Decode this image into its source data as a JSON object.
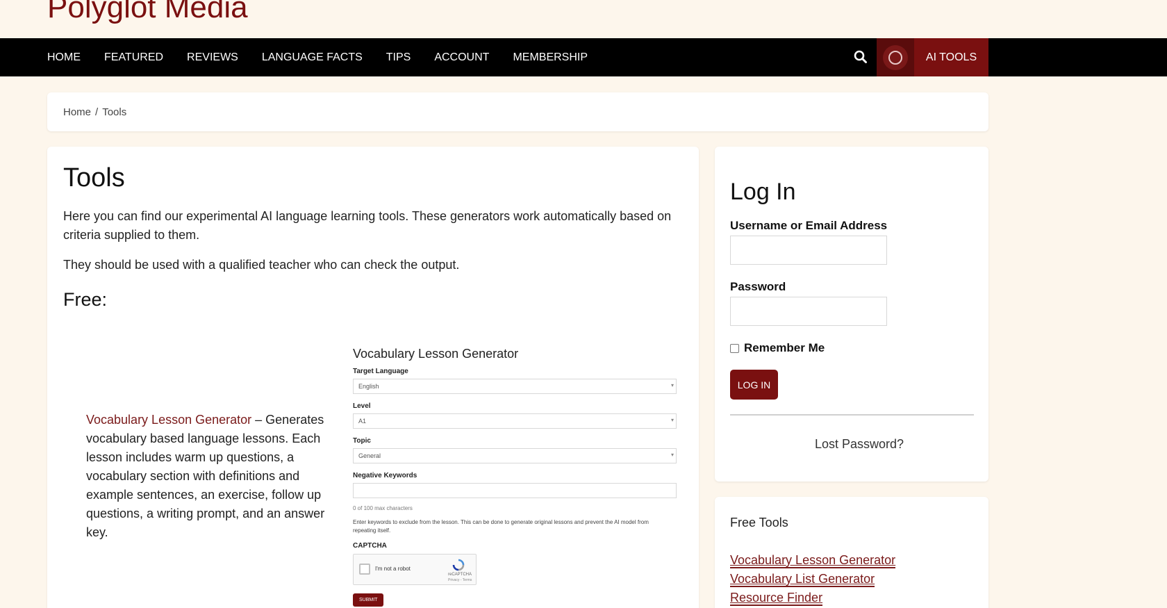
{
  "site": {
    "title": "Polyglot Media"
  },
  "nav": {
    "items": [
      "HOME",
      "FEATURED",
      "REVIEWS",
      "LANGUAGE FACTS",
      "TIPS",
      "ACCOUNT",
      "MEMBERSHIP"
    ],
    "ai_tools_label": "AI TOOLS",
    "search_icon": "search-icon",
    "accent_color": "#7a1010"
  },
  "breadcrumb": {
    "home": "Home",
    "separator": "/",
    "current": "Tools"
  },
  "main": {
    "title": "Tools",
    "intro_1": "Here you can find our experimental AI language learning tools. These generators work automatically based on criteria supplied to them.",
    "intro_2": "They should be used with a qualified teacher who can check the output.",
    "free_heading": "Free:",
    "tool": {
      "link": "Vocabulary Lesson Generator",
      "description": " – Generates vocabulary based language lessons. Each lesson includes warm up questions, a vocabulary section with definitions and example sentences, an exercise, follow up questions, a writing prompt, and an answer key."
    },
    "generator": {
      "title": "Vocabulary Lesson Generator",
      "target_language_label": "Target Language",
      "target_language_value": "English",
      "level_label": "Level",
      "level_value": "A1",
      "topic_label": "Topic",
      "topic_value": "General",
      "negative_keywords_label": "Negative Keywords",
      "negative_keywords_value": "",
      "char_count": "0 of 100 max characters",
      "help_text": "Enter keywords to exclude from the lesson. This can be done to generate original lessons and prevent the AI model from repeating itself.",
      "captcha_label": "CAPTCHA",
      "captcha_text": "I'm not a robot",
      "captcha_brand": "reCAPTCHA",
      "captcha_terms": "Privacy - Terms",
      "submit_label": "SUBMIT"
    }
  },
  "login": {
    "title": "Log In",
    "username_label": "Username or Email Address",
    "username_value": "",
    "password_label": "Password",
    "password_value": "",
    "remember_label": "Remember Me",
    "submit_label": "LOG IN",
    "lost_password": "Lost Password?"
  },
  "free_tools": {
    "title": "Free Tools",
    "links": [
      "Vocabulary Lesson Generator",
      "Vocabulary List Generator",
      "Resource Finder"
    ]
  }
}
